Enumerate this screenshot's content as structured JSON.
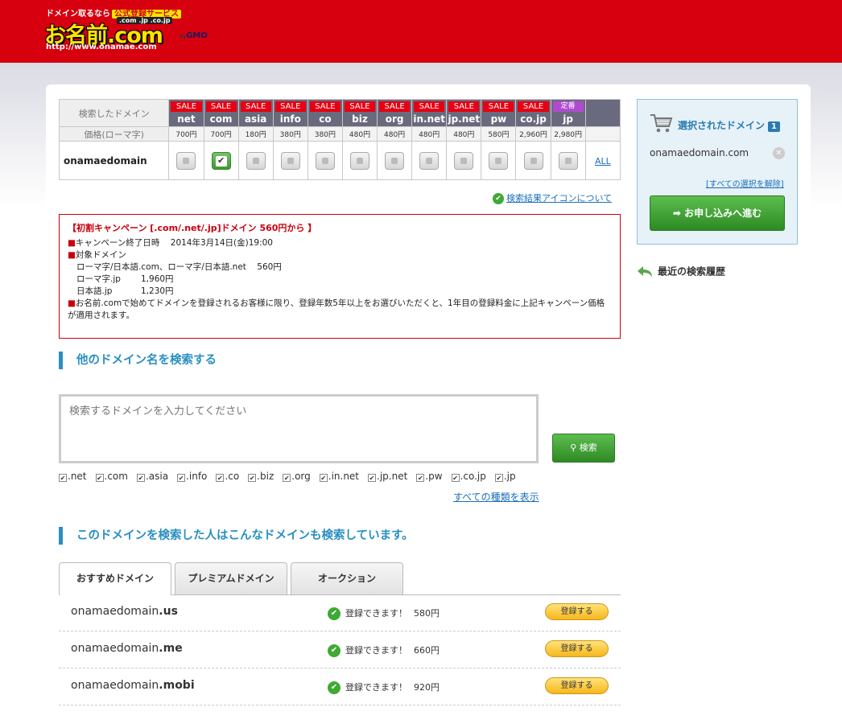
{
  "logo": {
    "tagline": "ドメイン取るなら",
    "tag_badge": "公式登録サービス",
    "tlds": ".com .jp .co.jp",
    "name": "お名前.com",
    "url": "http://www.onamae.com",
    "by": "by",
    "gmo": "GMO"
  },
  "results": {
    "header_label": "検索したドメイン",
    "price_label": "価格(ローマ字)",
    "domain": "onamaedomain",
    "all_link": "ALL",
    "tlds": [
      {
        "badge": "SALE",
        "name": "net",
        "price": "700円",
        "checked": false
      },
      {
        "badge": "SALE",
        "name": "com",
        "price": "700円",
        "checked": true
      },
      {
        "badge": "SALE",
        "name": "asia",
        "price": "180円",
        "checked": false
      },
      {
        "badge": "SALE",
        "name": "info",
        "price": "380円",
        "checked": false
      },
      {
        "badge": "SALE",
        "name": "co",
        "price": "380円",
        "checked": false
      },
      {
        "badge": "SALE",
        "name": "biz",
        "price": "480円",
        "checked": false
      },
      {
        "badge": "SALE",
        "name": "org",
        "price": "480円",
        "checked": false
      },
      {
        "badge": "SALE",
        "name": "in.net",
        "price": "480円",
        "checked": false
      },
      {
        "badge": "SALE",
        "name": "jp.net",
        "price": "480円",
        "checked": false
      },
      {
        "badge": "SALE",
        "name": "pw",
        "price": "580円",
        "checked": false
      },
      {
        "badge": "SALE",
        "name": "co.jp",
        "price": "2,960円",
        "checked": false
      },
      {
        "badge": "定番",
        "name": "jp",
        "price": "2,980円",
        "checked": false
      }
    ]
  },
  "about_link": "検索結果アイコンについて",
  "campaign": {
    "title": "【初割キャンペーン [.com/.net/.jp]ドメイン 560円から 】",
    "end_label": "キャンペーン終了日時",
    "end_date": "2014年3月14日(金)19:00",
    "target_label": "対象ドメイン",
    "line1_a": "ローマ字/日本語.com、ローマ字/日本語.net",
    "line1_b": "560円",
    "line2_a": "ローマ字.jp",
    "line2_b": "1,960円",
    "line3_a": "日本語.jp",
    "line3_b": "1,230円",
    "note": "お名前.comで始めてドメインを登録されるお客様に限り、登録年数5年以上をお選びいただくと、1年目の登録料金に上記キャンペーン価格が適用されます。"
  },
  "search": {
    "title": "他のドメイン名を検索する",
    "placeholder": "検索するドメインを入力してください",
    "button": "検索",
    "types": [
      ".net",
      ".com",
      ".asia",
      ".info",
      ".co",
      ".biz",
      ".org",
      ".in.net",
      ".jp.net",
      ".pw",
      ".co.jp",
      ".jp"
    ],
    "show_all": "すべての種類を表示"
  },
  "recommend": {
    "title": "このドメインを検索した人はこんなドメインも検索しています。",
    "tabs": [
      "おすすめドメイン",
      "プレミアムドメイン",
      "オークション"
    ],
    "rows": [
      {
        "base": "onamaedomain",
        "tld": ".us",
        "status": "登録できます！",
        "price": "580円",
        "button": "登録する"
      },
      {
        "base": "onamaedomain",
        "tld": ".me",
        "status": "登録できます！",
        "price": "660円",
        "button": "登録する"
      },
      {
        "base": "onamaedomain",
        "tld": ".mobi",
        "status": "登録できます！",
        "price": "920円",
        "button": "登録する"
      }
    ]
  },
  "sidebar": {
    "title": "選択されたドメイン",
    "count": "1",
    "selected_domain": "onamaedomain.com",
    "clear_link": "[すべての選択を解除]",
    "proceed_button": "お申し込みへ進む",
    "history": "最近の検索履歴"
  },
  "colors": {
    "header_red": "#d6000f",
    "sale_red": "#e60012",
    "accent_blue": "#2a8fc2",
    "green_button": "#3d9a33",
    "yellow_button": "#f6b71c"
  }
}
